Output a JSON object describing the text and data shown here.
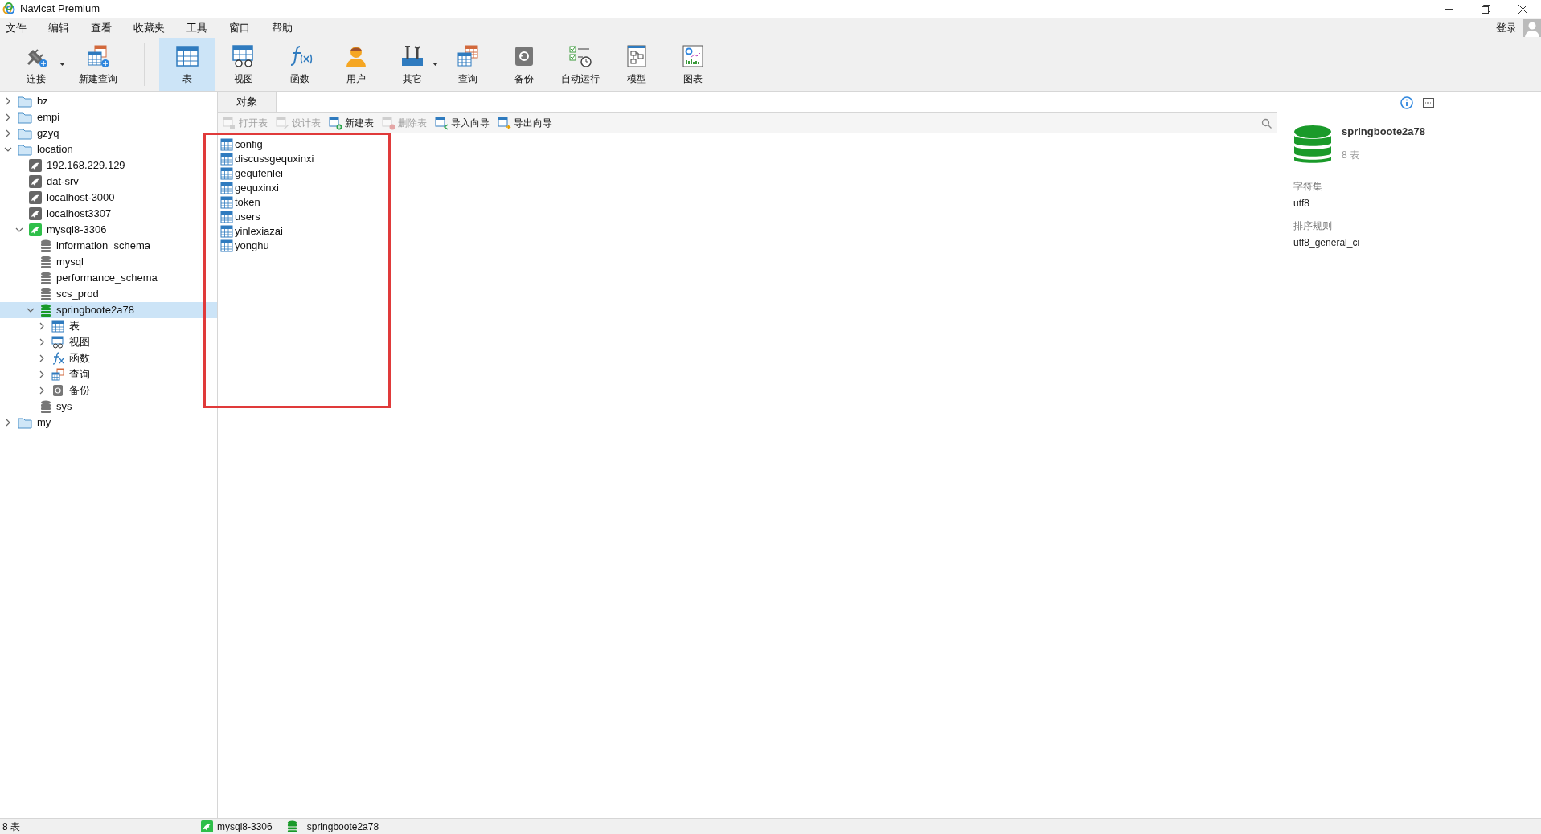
{
  "window": {
    "title": "Navicat Premium"
  },
  "menu": [
    "文件",
    "编辑",
    "查看",
    "收藏夹",
    "工具",
    "窗口",
    "帮助"
  ],
  "login": "登录",
  "toolbar": [
    {
      "kind": "connect",
      "label": "连接",
      "selected": false,
      "dropdown": true
    },
    {
      "kind": "newquery",
      "label": "新建查询",
      "selected": false,
      "dropdown": false,
      "separator": true
    },
    {
      "kind": "table",
      "label": "表",
      "selected": true,
      "dropdown": false
    },
    {
      "kind": "view",
      "label": "视图",
      "selected": false,
      "dropdown": false
    },
    {
      "kind": "function",
      "label": "函数",
      "selected": false,
      "dropdown": false
    },
    {
      "kind": "user",
      "label": "用户",
      "selected": false,
      "dropdown": false
    },
    {
      "kind": "other",
      "label": "其它",
      "selected": false,
      "dropdown": true
    },
    {
      "kind": "query",
      "label": "查询",
      "selected": false,
      "dropdown": false
    },
    {
      "kind": "backup",
      "label": "备份",
      "selected": false,
      "dropdown": false
    },
    {
      "kind": "schedule",
      "label": "自动运行",
      "selected": false,
      "dropdown": false
    },
    {
      "kind": "model",
      "label": "模型",
      "selected": false,
      "dropdown": false
    },
    {
      "kind": "chart",
      "label": "图表",
      "selected": false,
      "dropdown": false
    }
  ],
  "tree": [
    {
      "kind": "folder",
      "label": "bz",
      "expanded": false,
      "selected": false
    },
    {
      "kind": "folder",
      "label": "empi",
      "expanded": false,
      "selected": false
    },
    {
      "kind": "folder",
      "label": "gzyq",
      "expanded": false,
      "selected": false
    },
    {
      "kind": "folder",
      "label": "location",
      "expanded": true,
      "selected": false,
      "children": [
        {
          "kind": "connection",
          "label": "192.168.229.129",
          "open": false,
          "selected": false
        },
        {
          "kind": "connection",
          "label": "dat-srv",
          "open": false,
          "selected": false
        },
        {
          "kind": "connection",
          "label": "localhost-3000",
          "open": false,
          "selected": false
        },
        {
          "kind": "connection",
          "label": "localhost3307",
          "open": false,
          "selected": false
        },
        {
          "kind": "connection",
          "label": "mysql8-3306",
          "open": true,
          "expanded": true,
          "selected": false,
          "children": [
            {
              "kind": "database",
              "label": "information_schema",
              "open": false,
              "selected": false
            },
            {
              "kind": "database",
              "label": "mysql",
              "open": false,
              "selected": false
            },
            {
              "kind": "database",
              "label": "performance_schema",
              "open": false,
              "selected": false
            },
            {
              "kind": "database",
              "label": "scs_prod",
              "open": false,
              "selected": false
            },
            {
              "kind": "database",
              "label": "springboote2a78",
              "open": true,
              "expanded": true,
              "selected": true,
              "children": [
                {
                  "kind": "table",
                  "label": "表",
                  "expanded": false,
                  "selected": false
                },
                {
                  "kind": "view",
                  "label": "视图",
                  "expanded": false,
                  "selected": false
                },
                {
                  "kind": "function",
                  "label": "函数",
                  "expanded": false,
                  "selected": false
                },
                {
                  "kind": "query",
                  "label": "查询",
                  "expanded": false,
                  "selected": false
                },
                {
                  "kind": "backup",
                  "label": "备份",
                  "expanded": false,
                  "selected": false
                }
              ]
            },
            {
              "kind": "database",
              "label": "sys",
              "open": false,
              "selected": false
            }
          ]
        }
      ]
    },
    {
      "kind": "folder",
      "label": "my",
      "expanded": false,
      "selected": false
    }
  ],
  "object_tab": {
    "label": "对象",
    "selected": true
  },
  "object_actions": [
    {
      "kind": "open",
      "label": "打开表",
      "disabled": true
    },
    {
      "kind": "design",
      "label": "设计表",
      "disabled": true
    },
    {
      "kind": "new",
      "label": "新建表",
      "disabled": false
    },
    {
      "kind": "delete",
      "label": "删除表",
      "disabled": true
    },
    {
      "kind": "import",
      "label": "导入向导",
      "disabled": false
    },
    {
      "kind": "export",
      "label": "导出向导",
      "disabled": false
    }
  ],
  "tables": [
    "config",
    "discussgequxinxi",
    "gequfenlei",
    "gequxinxi",
    "token",
    "users",
    "yinlexiazai",
    "yonghu"
  ],
  "info": {
    "name": "springboote2a78",
    "count": "8 表",
    "fields": [
      {
        "label": "字符集",
        "value": "utf8"
      },
      {
        "label": "排序规则",
        "value": "utf8_general_ci"
      }
    ]
  },
  "status_bar": {
    "count": "8 表",
    "connection": "mysql8-3306",
    "database": "springboote2a78"
  }
}
